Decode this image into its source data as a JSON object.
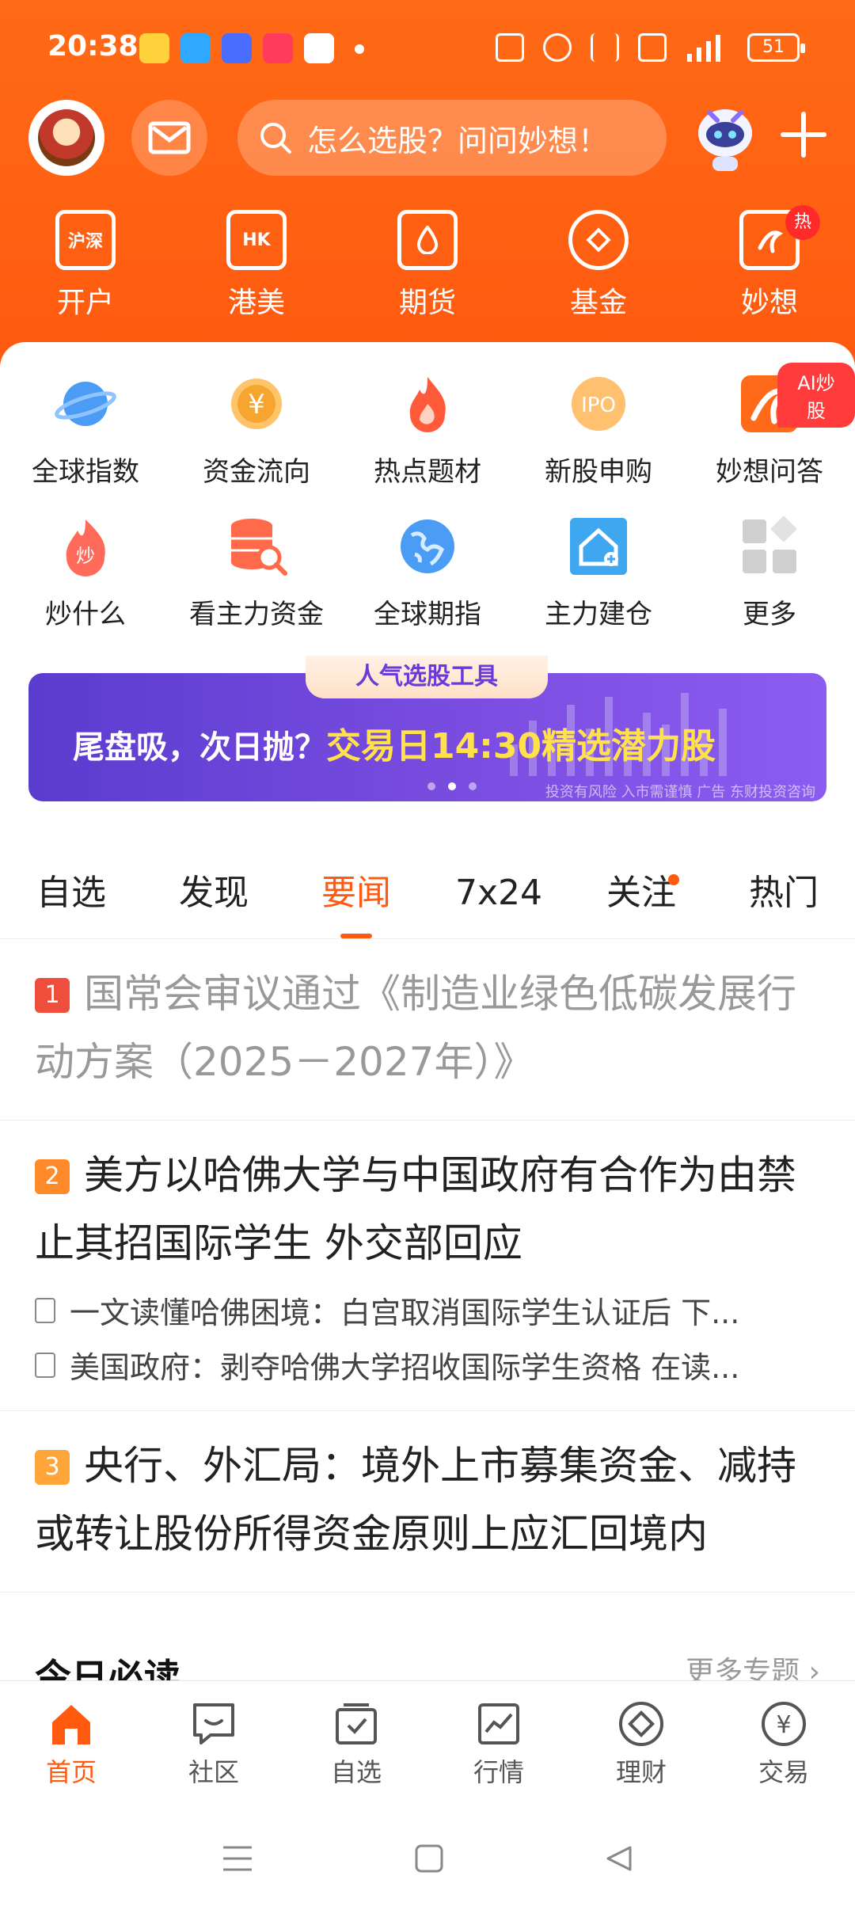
{
  "status_bar": {
    "time": "20:38",
    "battery": "51",
    "icons": [
      "nfc-icon",
      "mute-icon",
      "bluetooth-icon",
      "hd-icon",
      "5g-signal-icon",
      "battery-icon"
    ]
  },
  "header": {
    "search_placeholder": "怎么选股？问问妙想！",
    "top_nav": [
      {
        "label": "开户",
        "icon_text": "沪深",
        "icon": "account-open-icon"
      },
      {
        "label": "港美",
        "icon_text": "HK",
        "icon": "hk-us-icon"
      },
      {
        "label": "期货",
        "icon_text": "",
        "icon": "futures-icon"
      },
      {
        "label": "基金",
        "icon_text": "",
        "icon": "fund-icon"
      },
      {
        "label": "妙想",
        "icon_text": "",
        "icon": "miaoxiang-icon",
        "badge": "热"
      }
    ]
  },
  "grid": {
    "row1": [
      {
        "label": "全球指数",
        "icon": "planet-icon"
      },
      {
        "label": "资金流向",
        "icon": "yuan-coin-icon"
      },
      {
        "label": "热点题材",
        "icon": "flame-icon"
      },
      {
        "label": "新股申购",
        "icon": "ipo-icon",
        "icon_text": "IPO"
      },
      {
        "label": "妙想问答",
        "icon": "miaoxiang-qa-icon",
        "badge": "AI炒股"
      }
    ],
    "row2": [
      {
        "label": "炒什么",
        "icon": "hot-stock-icon",
        "icon_text": "炒"
      },
      {
        "label": "看主力资金",
        "icon": "database-search-icon"
      },
      {
        "label": "全球期指",
        "icon": "globe-icon"
      },
      {
        "label": "主力建仓",
        "icon": "house-chart-icon"
      },
      {
        "label": "更多",
        "icon": "more-grid-icon"
      }
    ]
  },
  "banner": {
    "tag": "人气选股工具",
    "text_a": "尾盘吸，次日抛？",
    "text_b": "交易日14:30精选潜力股",
    "footer": "投资有风险 入市需谨慎 广告 东财投资咨询"
  },
  "tabs": [
    "自选",
    "发现",
    "要闻",
    "7x24",
    "关注",
    "热门"
  ],
  "active_tab": "要闻",
  "news": [
    {
      "rank": "1",
      "title": "国常会审议通过《制造业绿色低碳发展行动方案（2025－2027年）》",
      "read": true,
      "subs": []
    },
    {
      "rank": "2",
      "title": "美方以哈佛大学与中国政府有合作为由禁止其招国际学生 外交部回应",
      "read": false,
      "subs": [
        "一文读懂哈佛困境：白宫取消国际学生认证后 下...",
        "美国政府：剥夺哈佛大学招收国际学生资格 在读..."
      ]
    },
    {
      "rank": "3",
      "title": "央行、外汇局：境外上市募集资金、减持或转让股份所得资金原则上应汇回境内",
      "read": false,
      "subs": []
    }
  ],
  "section": {
    "title": "今日必读",
    "more": "更多专题 ›"
  },
  "bottom_nav": [
    {
      "label": "首页",
      "icon": "home-icon",
      "active": true
    },
    {
      "label": "社区",
      "icon": "community-icon",
      "active": false
    },
    {
      "label": "自选",
      "icon": "watchlist-icon",
      "active": false
    },
    {
      "label": "行情",
      "icon": "market-chart-icon",
      "active": false
    },
    {
      "label": "理财",
      "icon": "finance-diamond-icon",
      "active": false
    },
    {
      "label": "交易",
      "icon": "trade-yuan-icon",
      "active": false
    }
  ],
  "colors": {
    "brand": "#ff5a10",
    "banner": "#6a45d8"
  }
}
